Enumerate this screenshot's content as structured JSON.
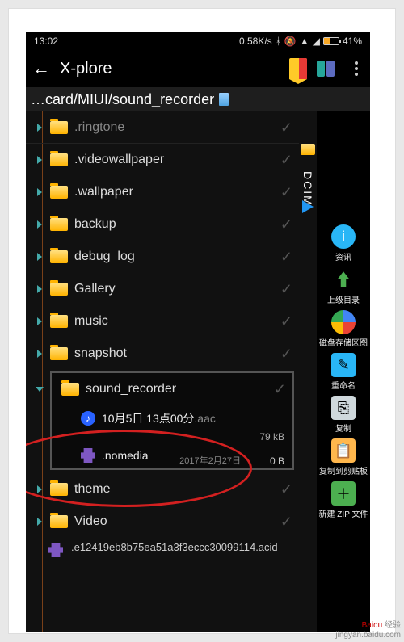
{
  "status": {
    "time": "13:02",
    "speed": "0.58K/s",
    "battery": "41%"
  },
  "app": {
    "title": "X-plore"
  },
  "breadcrumb": {
    "path": "…card/MIUI/sound_recorder"
  },
  "side_tab": {
    "label": "DCIM"
  },
  "folders": [
    {
      "name": ".ringtone"
    },
    {
      "name": ".videowallpaper"
    },
    {
      "name": ".wallpaper"
    },
    {
      "name": "backup"
    },
    {
      "name": "debug_log"
    },
    {
      "name": "Gallery"
    },
    {
      "name": "music"
    },
    {
      "name": "snapshot"
    }
  ],
  "selected": {
    "folder": "sound_recorder",
    "file_base": "10月5日 13点00分",
    "file_ext": ".aac",
    "file_size": "79 kB",
    "nomedia": ".nomedia",
    "nomedia_date": "2017年2月27日",
    "nomedia_size": "0 B"
  },
  "after": [
    {
      "name": "theme"
    },
    {
      "name": "Video"
    }
  ],
  "long_file": ".e12419eb8b75ea51a3f3eccc30099114.acid",
  "rail": {
    "info": "资讯",
    "up": "上级目录",
    "disk": "磁盘存储区图",
    "rename": "重命名",
    "copy": "复制",
    "clip": "复制到剪贴板",
    "zip": "新建 ZIP 文件"
  },
  "watermark": {
    "brand": "Baidu",
    "sub": "经验",
    "url": "jingyan.baidu.com"
  }
}
